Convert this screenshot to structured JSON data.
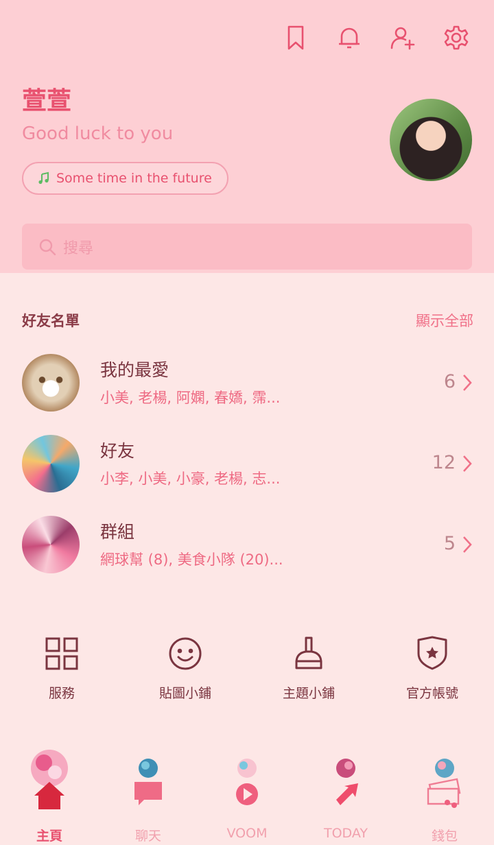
{
  "header": {
    "icons": [
      "bookmark-icon",
      "bell-icon",
      "add-friend-icon",
      "gear-icon"
    ],
    "profile_name": "萱萱",
    "status_message": "Good luck to you",
    "music": "Some time in the future",
    "search_placeholder": "搜尋"
  },
  "friends_section": {
    "title": "好友名單",
    "show_all": "顯示全部",
    "groups": [
      {
        "title": "我的最愛",
        "members": "小美, 老楊, 阿嫻, 春嬌, 霈...",
        "count": "6"
      },
      {
        "title": "好友",
        "members": "小李, 小美, 小豪, 老楊, 志...",
        "count": "12"
      },
      {
        "title": "群組",
        "members": "網球幫 (8), 美食小隊 (20)...",
        "count": "5"
      }
    ]
  },
  "services": [
    {
      "label": "服務",
      "icon": "grid-icon"
    },
    {
      "label": "貼圖小鋪",
      "icon": "smiley-icon"
    },
    {
      "label": "主題小鋪",
      "icon": "brush-icon"
    },
    {
      "label": "官方帳號",
      "icon": "shield-star-icon"
    }
  ],
  "bottom_nav": [
    {
      "label": "主頁",
      "icon": "home-icon",
      "active": true
    },
    {
      "label": "聊天",
      "icon": "chat-icon",
      "active": false
    },
    {
      "label": "VOOM",
      "icon": "play-icon",
      "active": false
    },
    {
      "label": "TODAY",
      "icon": "arrow-icon",
      "active": false
    },
    {
      "label": "錢包",
      "icon": "wallet-icon",
      "active": false
    }
  ],
  "colors": {
    "header_bg": "#fdcfd4",
    "body_bg": "#fde7e6",
    "accent": "#e8516f",
    "search_bg": "#fbbcc5"
  }
}
